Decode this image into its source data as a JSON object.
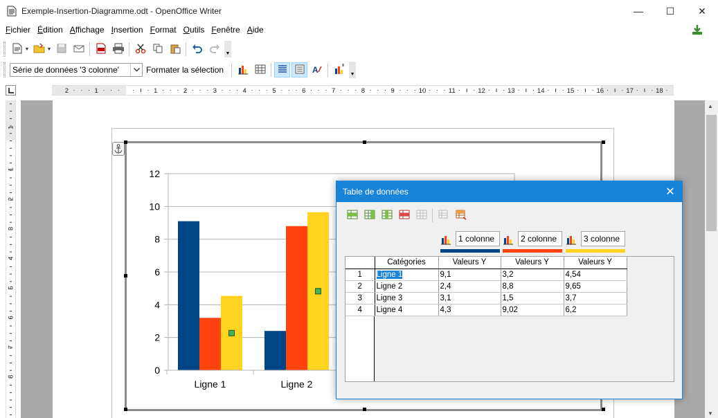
{
  "window": {
    "title": "Exemple-Insertion-Diagramme.odt - OpenOffice Writer",
    "minimize": "—",
    "maximize": "☐",
    "close": "✕"
  },
  "menu": [
    {
      "label": "Fichier"
    },
    {
      "label": "Édition"
    },
    {
      "label": "Affichage"
    },
    {
      "label": "Insertion"
    },
    {
      "label": "Format"
    },
    {
      "label": "Outils"
    },
    {
      "label": "Fenêtre"
    },
    {
      "label": "Aide"
    }
  ],
  "toolbar2": {
    "series_select": "Série de données '3 colonne'",
    "format_selection": "Formater la sélection"
  },
  "ruler": {
    "h_labels": [
      "2",
      "1",
      "1",
      "2",
      "3",
      "4",
      "5",
      "6",
      "7",
      "8",
      "9",
      "10",
      "11",
      "12",
      "13",
      "14",
      "15",
      "16",
      "17",
      "18"
    ],
    "v_labels": [
      "1",
      "1",
      "2",
      "3",
      "4",
      "5",
      "6",
      "7",
      "8"
    ]
  },
  "chart_data": {
    "type": "bar",
    "categories": [
      "Ligne 1",
      "Ligne 2",
      "Ligne 3",
      "Ligne 4"
    ],
    "visible_categories": [
      "Ligne 1",
      "Ligne 2"
    ],
    "series": [
      {
        "name": "1 colonne",
        "color": "#004586",
        "values": [
          9.1,
          2.4,
          3.1,
          4.3
        ]
      },
      {
        "name": "2 colonne",
        "color": "#ff420e",
        "values": [
          3.2,
          8.8,
          1.5,
          9.02
        ]
      },
      {
        "name": "3 colonne",
        "color": "#ffd320",
        "values": [
          4.54,
          9.65,
          3.7,
          6.2
        ]
      }
    ],
    "ylim": [
      0,
      12
    ],
    "yticks": [
      "0",
      "2",
      "4",
      "6",
      "8",
      "10",
      "12"
    ],
    "grid": true,
    "selected_series": "3 colonne",
    "selection_marker_color": "#4caf50"
  },
  "dialog": {
    "title": "Table de données",
    "close": "✕",
    "columns": {
      "categories": "Catégories",
      "values_y": "Valeurs Y"
    },
    "series_names": [
      "1 colonne",
      "2 colonne",
      "3 colonne"
    ],
    "series_colors": [
      "#004586",
      "#ff420e",
      "#ffd320"
    ],
    "rows": [
      {
        "num": "1",
        "cat": "Ligne 1",
        "v": [
          "9,1",
          "3,2",
          "4,54"
        ]
      },
      {
        "num": "2",
        "cat": "Ligne 2",
        "v": [
          "2,4",
          "8,8",
          "9,65"
        ]
      },
      {
        "num": "3",
        "cat": "Ligne 3",
        "v": [
          "3,1",
          "1,5",
          "3,7"
        ]
      },
      {
        "num": "4",
        "cat": "Ligne 4",
        "v": [
          "4,3",
          "9,02",
          "6,2"
        ]
      }
    ]
  }
}
